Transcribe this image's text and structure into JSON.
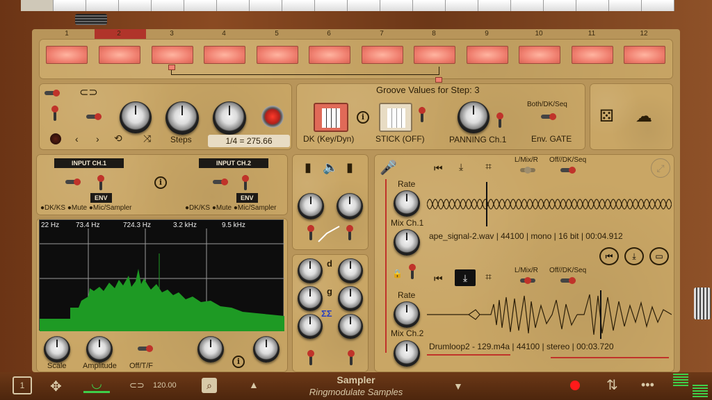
{
  "steps": [
    "1",
    "2",
    "3",
    "4",
    "5",
    "6",
    "7",
    "8",
    "9",
    "10",
    "11",
    "12"
  ],
  "groove": {
    "title": "Groove Values for Step: 3",
    "dk_label": "DK (Key/Dyn)",
    "stick_label": "STICK (OFF)",
    "panning_label": "PANNING Ch.1",
    "env_label": "Env. GATE",
    "mode_label": "Both/DK/Seq"
  },
  "control": {
    "steps_label": "Steps",
    "tempo_readout": "1/4 = 275.66"
  },
  "inputs": {
    "ch1_title": "INPUT CH.1",
    "ch2_title": "INPUT CH.2",
    "env": "ENV",
    "ch1_options": "●DK/KS ●Mute ●Mic/Sampler",
    "ch2_options": "●DK/KS ●Mute ●Mic/Sampler"
  },
  "spectrum": {
    "freq_labels": [
      "22 Hz",
      "73.4 Hz",
      "724.3 Hz",
      "3.2 kHz",
      "9.5 kHz"
    ],
    "scale_label": "Scale",
    "amplitude_label": "Amplitude",
    "offtf_label": "Off/T/F"
  },
  "mixer": {
    "d_label": "d",
    "g_label": "g",
    "sigma": "ΣΣ"
  },
  "sampler1": {
    "rate_label": "Rate",
    "mix_label": "Mix Ch.1",
    "lmr_label": "L/Mix/R",
    "mode_label": "Off//DK/Seq",
    "info": "ape_signal-2.wav | 44100 | mono | 16 bit | 00:04.912"
  },
  "sampler2": {
    "rate_label": "Rate",
    "mix_label": "Mix Ch.2",
    "lmr_label": "L/Mix/R",
    "mode_label": "Off//DK/Seq",
    "info": "Drumloop2 - 129.m4a | 44100 | stereo  | 00:03.720"
  },
  "bottom": {
    "bpm": "120.00",
    "title": "Sampler",
    "subtitle": "Ringmodulate Samples"
  },
  "colors": {
    "accent_red": "#c0332a",
    "wood": "#6b3415",
    "panel": "#c9a665"
  }
}
